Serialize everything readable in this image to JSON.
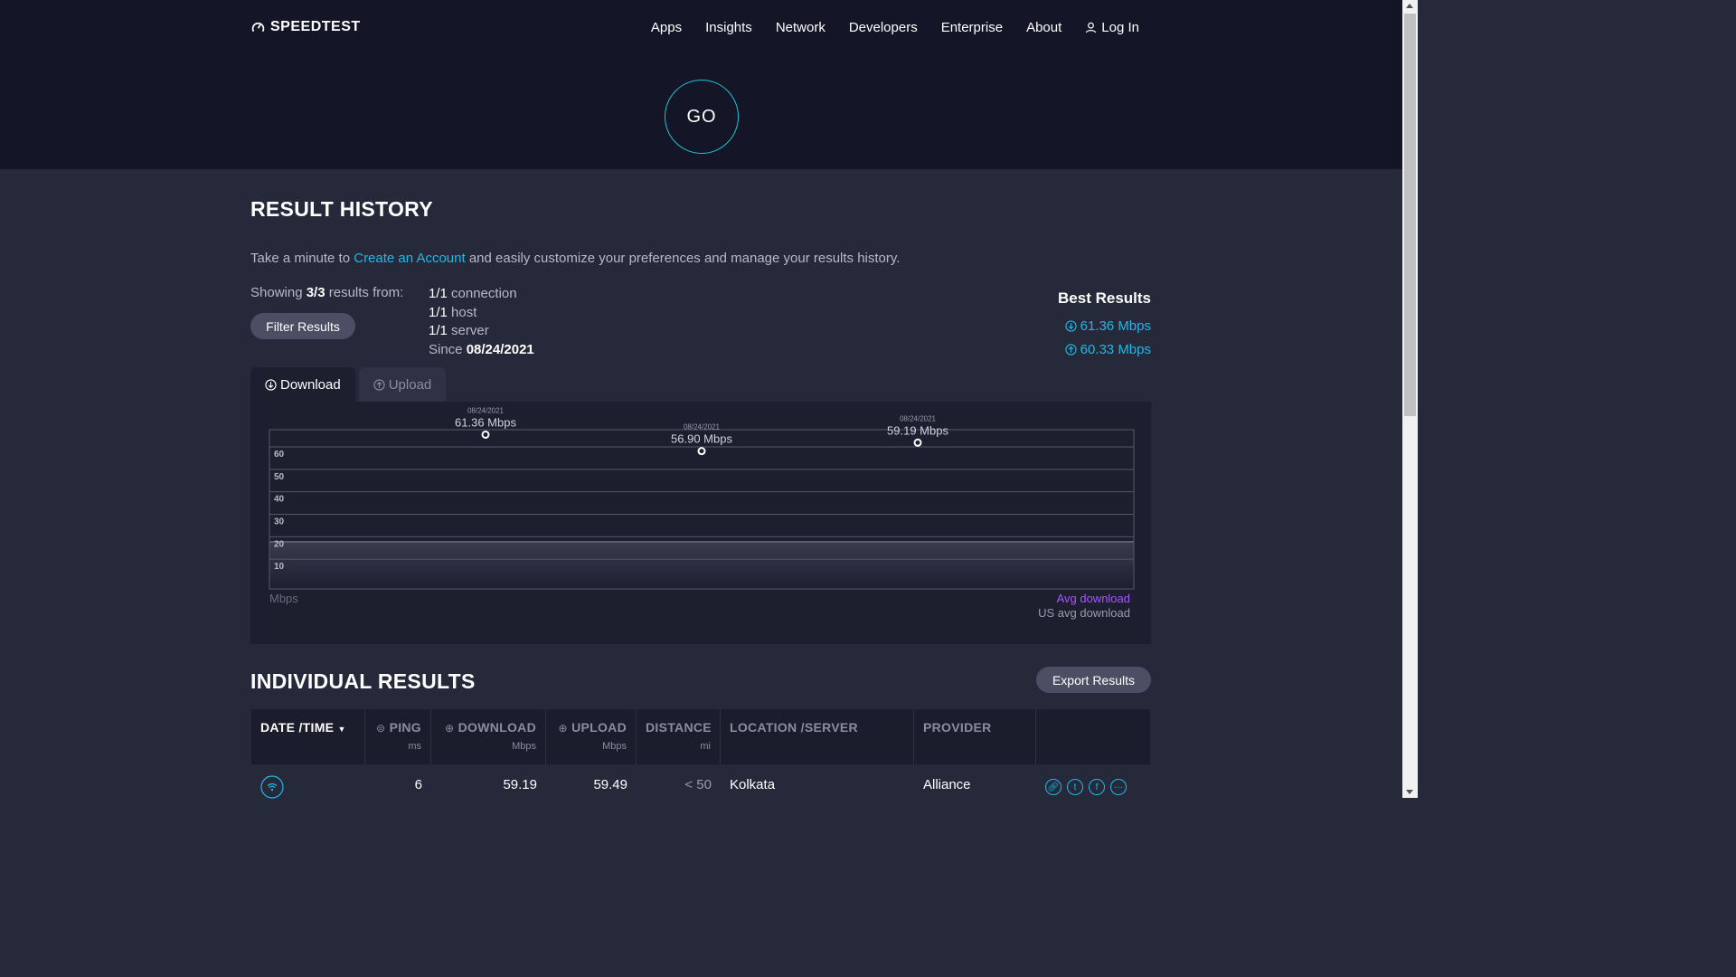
{
  "header": {
    "logo": "SPEEDTEST",
    "nav": [
      "Apps",
      "Insights",
      "Network",
      "Developers",
      "Enterprise",
      "About"
    ],
    "login": "Log In",
    "go": "GO"
  },
  "history": {
    "title": "RESULT HISTORY",
    "intro_before": "Take a minute to ",
    "intro_link": "Create an Account",
    "intro_after": " and easily customize your preferences and manage your results history.",
    "showing_prefix": "Showing ",
    "showing_count": "3/3",
    "showing_suffix": " results from:",
    "filter_button": "Filter Results",
    "meta": [
      {
        "value": "1/1",
        "label": " connection"
      },
      {
        "value": "1/1",
        "label": " host"
      },
      {
        "value": "1/1",
        "label": " server"
      }
    ],
    "since_label": "Since ",
    "since_value": "08/24/2021",
    "best_title": "Best Results",
    "best_download": "61.36 Mbps",
    "best_upload": "60.33 Mbps"
  },
  "tabs": {
    "download": "Download",
    "upload": "Upload"
  },
  "chart_data": {
    "type": "line",
    "x": [
      "08/24/2021",
      "08/24/2021",
      "08/24/2021"
    ],
    "values": [
      61.36,
      56.9,
      59.19
    ],
    "point_labels": [
      "61.36 Mbps",
      "56.90 Mbps",
      "59.19 Mbps"
    ],
    "ylim": [
      0,
      60
    ],
    "yticks": [
      60,
      50,
      40,
      30,
      20,
      10
    ],
    "ylabel": "Mbps",
    "us_avg_band": [
      20,
      21
    ],
    "legend": [
      "Avg download",
      "US avg download"
    ],
    "legend_colors": {
      "avg": "#a556ff",
      "us": "#9a9cae"
    },
    "grid": true
  },
  "results": {
    "title": "INDIVIDUAL RESULTS",
    "export_button": "Export Results",
    "columns": [
      {
        "label": "DATE /TIME",
        "unit": ""
      },
      {
        "label": "PING",
        "unit": "ms"
      },
      {
        "label": "DOWNLOAD",
        "unit": "Mbps"
      },
      {
        "label": "UPLOAD",
        "unit": "Mbps"
      },
      {
        "label": "DISTANCE",
        "unit": "mi"
      },
      {
        "label": "LOCATION /SERVER",
        "unit": ""
      },
      {
        "label": "PROVIDER",
        "unit": ""
      }
    ],
    "rows": [
      {
        "ping": "6",
        "download": "59.19",
        "upload": "59.49",
        "distance": "< 50",
        "location": "Kolkata",
        "provider": "Alliance"
      }
    ]
  },
  "colors": {
    "accent": "#1eb9e6",
    "go_ring": "#1fc3d6",
    "header_bg": "#141526",
    "page_bg": "#262939"
  }
}
